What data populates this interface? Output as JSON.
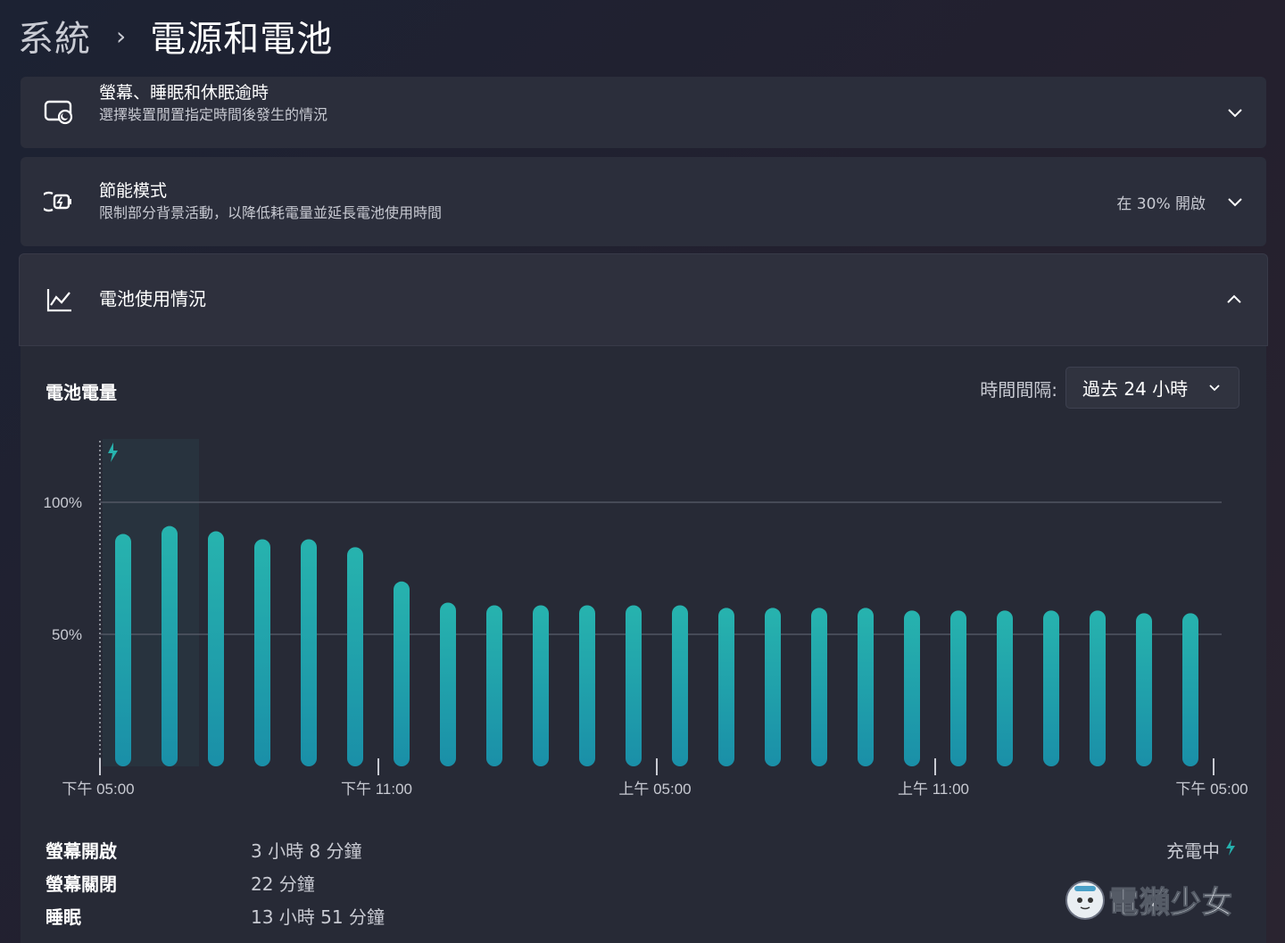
{
  "breadcrumb": {
    "parent": "系統",
    "separator": "›",
    "current": "電源和電池"
  },
  "cards": {
    "screen_sleep": {
      "title": "螢幕、睡眠和休眠逾時",
      "subtitle": "選擇裝置閒置指定時間後發生的情況"
    },
    "energy_saver": {
      "title": "節能模式",
      "subtitle": "限制部分背景活動，以降低耗電量並延長電池使用時間",
      "status": "在 30% 開啟"
    },
    "battery_usage": {
      "title": "電池使用情況"
    }
  },
  "battery": {
    "section_label": "電池電量",
    "interval_label": "時間間隔:",
    "interval_value": "過去 24 小時",
    "stats": [
      {
        "label": "螢幕開啟",
        "value": "3 小時 8 分鐘"
      },
      {
        "label": "螢幕關閉",
        "value": "22 分鐘"
      },
      {
        "label": "睡眠",
        "value": "13 小時 51 分鐘"
      }
    ],
    "charging_label": "充電中"
  },
  "chart_data": {
    "type": "bar",
    "ylim": [
      0,
      100
    ],
    "yticks": [
      "100%",
      "50%"
    ],
    "xticks": [
      "下午 05:00",
      "下午 11:00",
      "上午 05:00",
      "上午 11:00",
      "下午 05:00"
    ],
    "values": [
      88,
      91,
      89,
      86,
      86,
      83,
      70,
      62,
      61,
      61,
      61,
      61,
      61,
      60,
      60,
      60,
      60,
      59,
      59,
      59,
      59,
      59,
      58,
      58
    ],
    "charging_period_bars": 2,
    "grid": true,
    "colors": {
      "bar_top": "#27b3ae",
      "bar_bottom": "#1a8fa8",
      "grid": "#5a5e6b",
      "charging_highlight": "#2a3a44"
    }
  },
  "watermark": {
    "text": "電獺少女"
  },
  "colors": {
    "accent": "#25b0ad",
    "card_bg": "#2b2e3b",
    "text_secondary": "#c8cad2"
  }
}
